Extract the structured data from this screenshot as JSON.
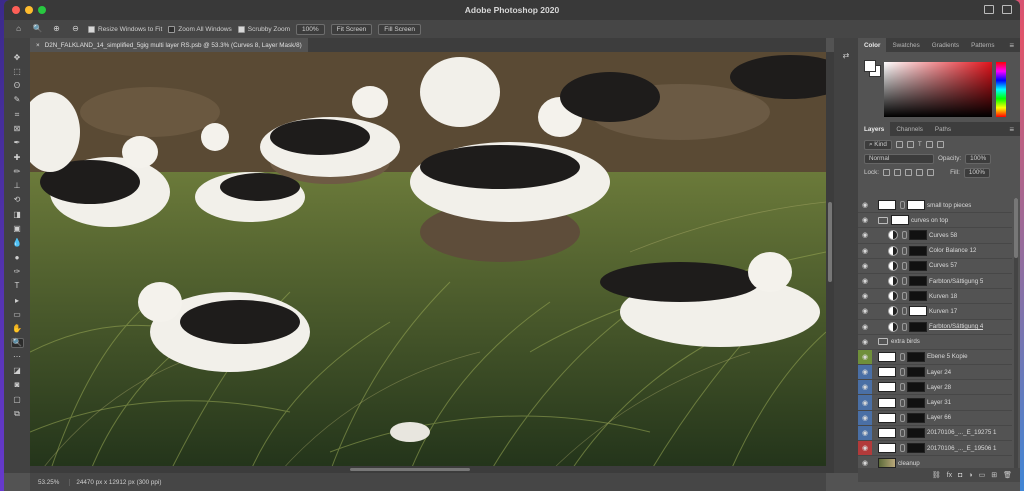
{
  "app": {
    "title": "Adobe Photoshop 2020"
  },
  "options": {
    "resize_windows": "Resize Windows to Fit",
    "zoom_all": "Zoom All Windows",
    "scrubby_zoom": "Scrubby Zoom",
    "zoom_value": "100%",
    "fit_screen": "Fit Screen",
    "fill_screen": "Fill Screen",
    "resize_checked": true,
    "zoom_all_checked": false,
    "scrubby_checked": true
  },
  "document": {
    "tab_label": "D2N_FALKLAND_14_simplified_5gig multi layer RS.psb @ 53.3% (Curves 8, Layer Mask/8)",
    "close_glyph": "×"
  },
  "status": {
    "zoom": "53.25%",
    "dimensions": "24470 px x 12912 px (300 ppi)"
  },
  "color_panel": {
    "tabs": [
      "Color",
      "Swatches",
      "Gradients",
      "Patterns"
    ],
    "foreground": "#ffffff",
    "background": "#ffffff"
  },
  "layers_panel": {
    "tabs": [
      "Layers",
      "Channels",
      "Paths"
    ],
    "kind_label": "Kind",
    "blend_mode": "Normal",
    "opacity_label": "Opacity:",
    "opacity_value": "100%",
    "lock_label": "Lock:",
    "fill_label": "Fill:",
    "fill_value": "100%",
    "layers": [
      {
        "name": "small top pieces",
        "type": "layer",
        "thumb": "white",
        "eye": true,
        "color": ""
      },
      {
        "name": "curves on top",
        "type": "group",
        "thumb": "white",
        "eye": true,
        "color": ""
      },
      {
        "name": "Curves 58",
        "type": "adjustment",
        "thumb": "black",
        "eye": true,
        "color": ""
      },
      {
        "name": "Color Balance 12",
        "type": "adjustment",
        "thumb": "black",
        "eye": true,
        "color": ""
      },
      {
        "name": "Curves 57",
        "type": "adjustment",
        "thumb": "black",
        "eye": true,
        "color": ""
      },
      {
        "name": "Farbton/Sättigung 5",
        "type": "adjustment",
        "thumb": "black",
        "eye": true,
        "color": ""
      },
      {
        "name": "Kurven 18",
        "type": "adjustment",
        "thumb": "black",
        "eye": true,
        "color": ""
      },
      {
        "name": "Kurven 17",
        "type": "adjustment",
        "thumb": "white",
        "eye": true,
        "color": ""
      },
      {
        "name": "Farbton/Sättigung 4",
        "type": "adjustment",
        "thumb": "black",
        "eye": true,
        "color": "",
        "underline": true
      },
      {
        "name": "extra birds",
        "type": "group",
        "thumb": "",
        "eye": true,
        "color": ""
      },
      {
        "name": "Ebene 5 Kopie",
        "type": "layer",
        "thumb": "black",
        "eye": true,
        "color": "#6f8f3a"
      },
      {
        "name": "Layer 24",
        "type": "layer",
        "thumb": "black",
        "eye": true,
        "color": "#4a6fa5"
      },
      {
        "name": "Layer 28",
        "type": "layer",
        "thumb": "black",
        "eye": true,
        "color": "#4a6fa5"
      },
      {
        "name": "Layer 31",
        "type": "layer",
        "thumb": "black",
        "eye": true,
        "color": "#4a6fa5"
      },
      {
        "name": "Layer 66",
        "type": "layer",
        "thumb": "black",
        "eye": true,
        "color": "#4a6fa5"
      },
      {
        "name": "20170106_..._E_19275 1",
        "type": "layer",
        "thumb": "black",
        "eye": true,
        "color": "#4a6fa5"
      },
      {
        "name": "20170106_..._E_19506 1",
        "type": "layer",
        "thumb": "black",
        "eye": true,
        "color": "#b23a3a"
      },
      {
        "name": "cleanup",
        "type": "layer",
        "thumb": "photo",
        "eye": true,
        "color": ""
      }
    ],
    "bottom_icons": [
      "link-icon",
      "fx",
      "mask-icon",
      "adjustment-icon",
      "folder-icon",
      "new-layer-icon",
      "trash-icon"
    ],
    "bottom_glyphs": [
      "⛓",
      "fx",
      "◘",
      "◑",
      "▭",
      "⊞",
      "🗑"
    ]
  },
  "tools": [
    "move",
    "marquee",
    "lasso",
    "quick-select",
    "crop",
    "frame",
    "eyedropper",
    "healing",
    "brush",
    "stamp",
    "history-brush",
    "eraser",
    "gradient",
    "blur",
    "dodge",
    "pen",
    "type",
    "path-select",
    "rectangle",
    "hand",
    "zoom",
    "more",
    "colors",
    "quick-mask",
    "screen-mode",
    "artboard"
  ],
  "tool_glyphs": [
    "✥",
    "⬚",
    "ʘ",
    "✎",
    "⌗",
    "⊠",
    "✒",
    "✚",
    "✏",
    "⊥",
    "⟲",
    "◨",
    "▣",
    "💧",
    "●",
    "✑",
    "T",
    "▸",
    "▭",
    "✋",
    "🔍",
    "⋯",
    "◪",
    "◙",
    "▢",
    "⧉"
  ]
}
